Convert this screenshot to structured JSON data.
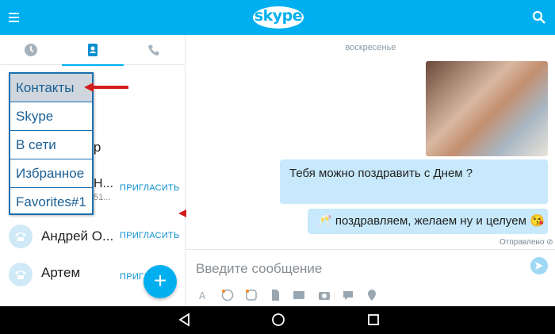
{
  "app": {
    "brand": "skype",
    "accent": "#00aff0"
  },
  "header": {
    "menu_icon": "hamburger-menu-icon",
    "search_icon": "search-icon"
  },
  "tabs": [
    {
      "icon": "clock-icon",
      "name": "recent"
    },
    {
      "icon": "contacts-book-icon",
      "name": "contacts",
      "active": true
    },
    {
      "icon": "phone-icon",
      "name": "calls"
    }
  ],
  "dropdown": {
    "items": [
      "Контакты",
      "Skype",
      "В сети",
      "Избранное",
      "Favorites#1"
    ],
    "selected": "Контакты"
  },
  "contacts": [
    {
      "name_partial": "др"
    },
    {
      "name_partial": "Н...",
      "sub": "51...",
      "invite": "ПРИГЛАСИТЬ"
    },
    {
      "name": "Андрей О...",
      "invite": "ПРИГЛАСИТЬ"
    },
    {
      "name": "Артем",
      "invite": "ПРИГЛА"
    }
  ],
  "chat": {
    "day": "воскресенье",
    "messages": [
      {
        "text": "Тебя можно поздравить с Днем ?"
      },
      {
        "text": "🥂 поздравляем, желаем ну и целуем 😘"
      }
    ],
    "status": "Отправлено"
  },
  "composer": {
    "placeholder": "Введите сообщение"
  },
  "fab": {
    "label": "+"
  }
}
